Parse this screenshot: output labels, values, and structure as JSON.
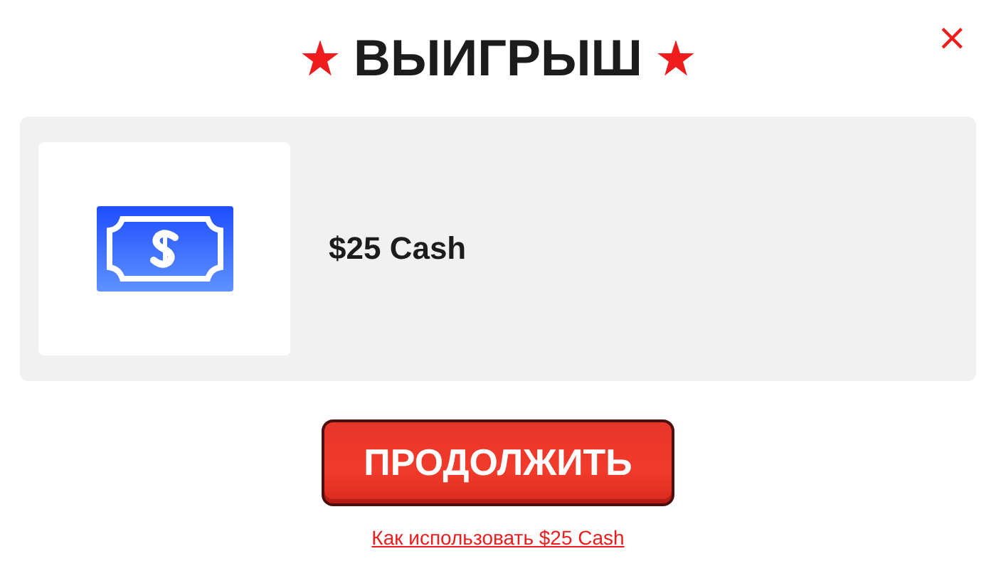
{
  "dialog": {
    "title": "ВЫИГРЫШ",
    "close": "×"
  },
  "prize": {
    "name": "$25 Cash"
  },
  "continue_button": "ПРОДОЛЖИТЬ",
  "help_link": "Как использовать $25 Cash"
}
